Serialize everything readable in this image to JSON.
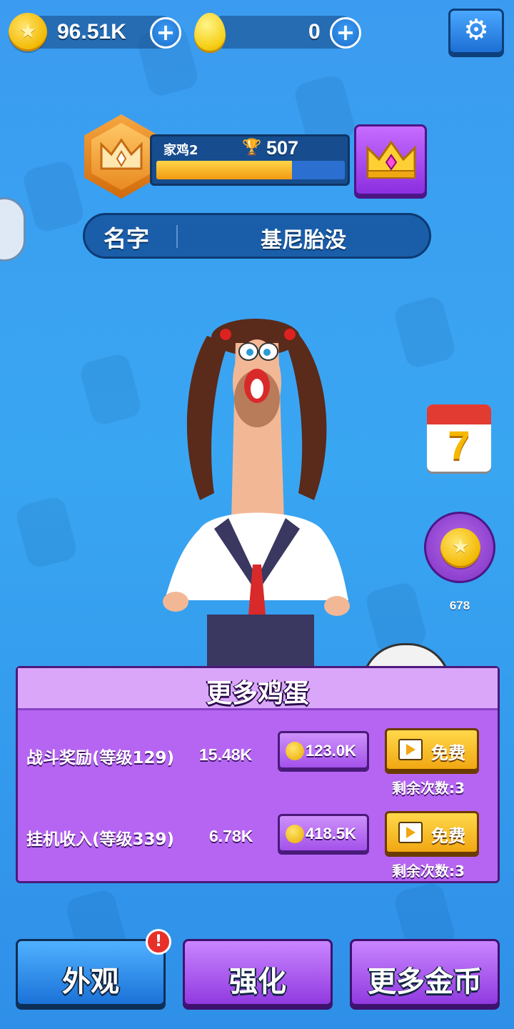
{
  "currency": {
    "coins": "96.51K",
    "eggs": "0"
  },
  "rank": {
    "level_name": "家鸡2",
    "trophies": "507",
    "progress": 0.72
  },
  "profile": {
    "name_label": "名字",
    "name_value": "基尼胎没"
  },
  "side": {
    "calendar_day": "7",
    "coin_reward": "678"
  },
  "panel": {
    "title": "更多鸡蛋",
    "rows": [
      {
        "label": "战斗奖励(等级129)",
        "amount": "15.48K",
        "price": "123.0K",
        "free_label": "免费",
        "remaining": "剩余次数:3"
      },
      {
        "label": "挂机收入(等级339)",
        "amount": "6.78K",
        "price": "418.5K",
        "free_label": "免费",
        "remaining": "剩余次数:3"
      }
    ]
  },
  "nav": {
    "appearance": "外观",
    "upgrade": "强化",
    "more_coins": "更多金币",
    "alert": "!"
  },
  "colors": {
    "background": "#3b9bf0",
    "panel": "#b665f2",
    "accent_yellow": "#f6b800"
  }
}
